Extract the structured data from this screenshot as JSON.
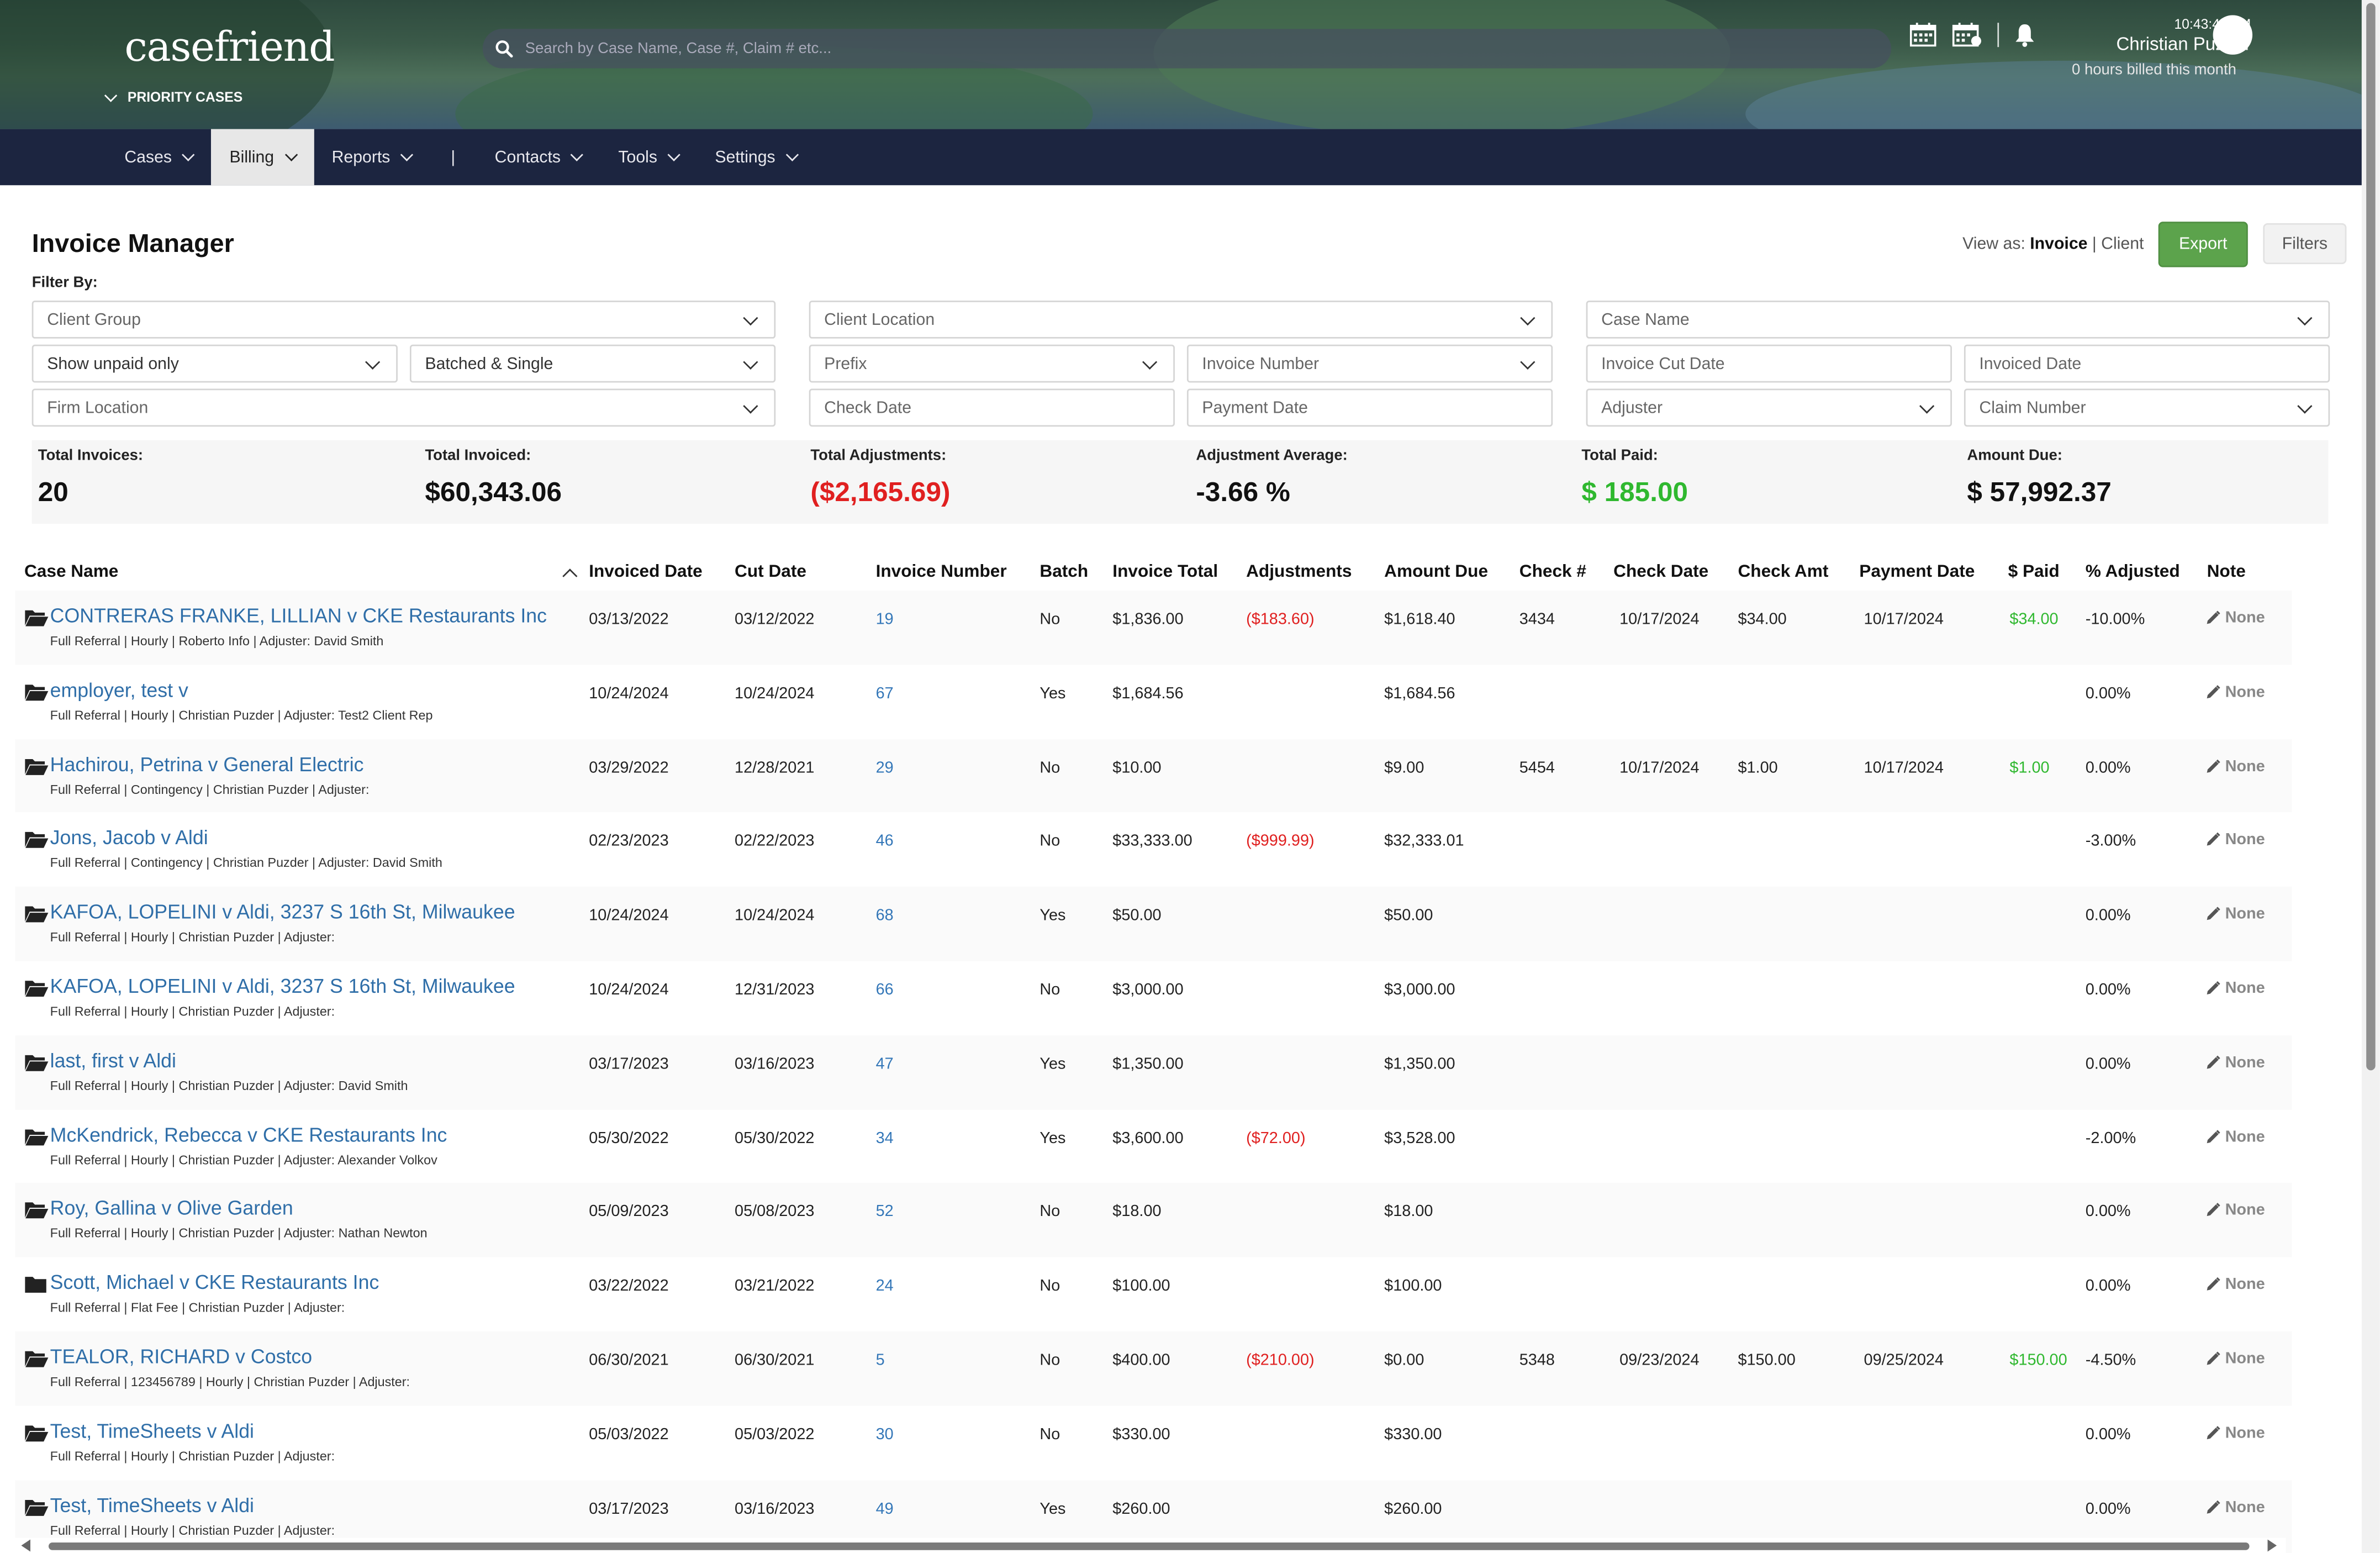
{
  "brand": {
    "logo_text": "casefriend",
    "priority_label": "PRIORITY CASES"
  },
  "search": {
    "placeholder": "Search by Case Name, Case #, Claim # etc..."
  },
  "header": {
    "clock": "10:43:43 AM",
    "user_name": "Christian Puzder",
    "billed": "0 hours billed this month"
  },
  "nav": [
    "Cases",
    "Billing",
    "Reports",
    "|",
    "Contacts",
    "Tools",
    "Settings"
  ],
  "page": {
    "title": "Invoice Manager",
    "view_as_label": "View as:",
    "view_invoice": "Invoice",
    "view_sep": "|",
    "view_client": "Client",
    "export_label": "Export",
    "filters_label": "Filters",
    "filter_by": "Filter By:"
  },
  "filters": {
    "client_group": "Client Group",
    "client_location": "Client Location",
    "case_name": "Case Name",
    "unpaid": "Show unpaid only",
    "batched": "Batched & Single",
    "prefix": "Prefix",
    "invoice_number": "Invoice Number",
    "invoice_cut_date": "Invoice Cut Date",
    "invoiced_date": "Invoiced Date",
    "firm_location": "Firm Location",
    "check_date": "Check Date",
    "payment_date": "Payment Date",
    "adjuster": "Adjuster",
    "claim_number": "Claim Number"
  },
  "summary": {
    "total_invoices_label": "Total Invoices:",
    "total_invoices": "20",
    "total_invoiced_label": "Total Invoiced:",
    "total_invoiced": "$60,343.06",
    "total_adjustments_label": "Total Adjustments:",
    "total_adjustments": "($2,165.69)",
    "adjustment_average_label": "Adjustment Average:",
    "adjustment_average": "-3.66 %",
    "total_paid_label": "Total Paid:",
    "total_paid": "$ 185.00",
    "amount_due_label": "Amount Due:",
    "amount_due": "$ 57,992.37"
  },
  "table": {
    "headers": {
      "case_name": "Case Name",
      "invoiced_date": "Invoiced Date",
      "cut_date": "Cut Date",
      "invoice_number": "Invoice Number",
      "batch": "Batch",
      "invoice_total": "Invoice Total",
      "adjustments": "Adjustments",
      "amount_due": "Amount Due",
      "check_no": "Check #",
      "check_date": "Check Date",
      "check_amt": "Check Amt",
      "payment_date": "Payment Date",
      "paid": "$ Paid",
      "pct_adjusted": "% Adjusted",
      "note": "Note"
    },
    "rows": [
      {
        "case": "CONTRERAS FRANKE, LILLIAN v CKE Restaurants Inc",
        "sub": "Full Referral | Hourly | Roberto Info | Adjuster: David Smith",
        "invoiced": "03/13/2022",
        "cut": "03/12/2022",
        "inv": "19",
        "batch": "No",
        "total": "$1,836.00",
        "adj": "($183.60)",
        "due": "$1,618.40",
        "check": "3434",
        "check_date": "10/17/2024",
        "check_amt": "$34.00",
        "pay_date": "10/17/2024",
        "paid": "$34.00",
        "pct": "-10.00%",
        "note": "None"
      },
      {
        "case": "employer, test v",
        "sub": "Full Referral | Hourly | Christian Puzder | Adjuster: Test2 Client Rep",
        "invoiced": "10/24/2024",
        "cut": "10/24/2024",
        "inv": "67",
        "batch": "Yes",
        "total": "$1,684.56",
        "adj": "",
        "due": "$1,684.56",
        "check": "",
        "check_date": "",
        "check_amt": "",
        "pay_date": "",
        "paid": "",
        "pct": "0.00%",
        "note": "None"
      },
      {
        "case": "Hachirou, Petrina v General Electric",
        "sub": "Full Referral | Contingency | Christian Puzder | Adjuster:",
        "invoiced": "03/29/2022",
        "cut": "12/28/2021",
        "inv": "29",
        "batch": "No",
        "total": "$10.00",
        "adj": "",
        "due": "$9.00",
        "check": "5454",
        "check_date": "10/17/2024",
        "check_amt": "$1.00",
        "pay_date": "10/17/2024",
        "paid": "$1.00",
        "pct": "0.00%",
        "note": "None"
      },
      {
        "case": "Jons, Jacob v Aldi",
        "sub": "Full Referral | Contingency | Christian Puzder | Adjuster: David Smith",
        "invoiced": "02/23/2023",
        "cut": "02/22/2023",
        "inv": "46",
        "batch": "No",
        "total": "$33,333.00",
        "adj": "($999.99)",
        "due": "$32,333.01",
        "check": "",
        "check_date": "",
        "check_amt": "",
        "pay_date": "",
        "paid": "",
        "pct": "-3.00%",
        "note": "None"
      },
      {
        "case": "KAFOA, LOPELINI v Aldi, 3237 S 16th St, Milwaukee",
        "sub": "Full Referral | Hourly | Christian Puzder | Adjuster:",
        "invoiced": "10/24/2024",
        "cut": "10/24/2024",
        "inv": "68",
        "batch": "Yes",
        "total": "$50.00",
        "adj": "",
        "due": "$50.00",
        "check": "",
        "check_date": "",
        "check_amt": "",
        "pay_date": "",
        "paid": "",
        "pct": "0.00%",
        "note": "None"
      },
      {
        "case": "KAFOA, LOPELINI v Aldi, 3237 S 16th St, Milwaukee",
        "sub": "Full Referral | Hourly | Christian Puzder | Adjuster:",
        "invoiced": "10/24/2024",
        "cut": "12/31/2023",
        "inv": "66",
        "batch": "No",
        "total": "$3,000.00",
        "adj": "",
        "due": "$3,000.00",
        "check": "",
        "check_date": "",
        "check_amt": "",
        "pay_date": "",
        "paid": "",
        "pct": "0.00%",
        "note": "None"
      },
      {
        "case": "last, first v Aldi",
        "sub": "Full Referral | Hourly | Christian Puzder | Adjuster: David Smith",
        "invoiced": "03/17/2023",
        "cut": "03/16/2023",
        "inv": "47",
        "batch": "Yes",
        "total": "$1,350.00",
        "adj": "",
        "due": "$1,350.00",
        "check": "",
        "check_date": "",
        "check_amt": "",
        "pay_date": "",
        "paid": "",
        "pct": "0.00%",
        "note": "None"
      },
      {
        "case": "McKendrick, Rebecca v CKE Restaurants Inc",
        "sub": "Full Referral | Hourly | Christian Puzder | Adjuster: Alexander Volkov",
        "invoiced": "05/30/2022",
        "cut": "05/30/2022",
        "inv": "34",
        "batch": "Yes",
        "total": "$3,600.00",
        "adj": "($72.00)",
        "due": "$3,528.00",
        "check": "",
        "check_date": "",
        "check_amt": "",
        "pay_date": "",
        "paid": "",
        "pct": "-2.00%",
        "note": "None"
      },
      {
        "case": "Roy, Gallina v Olive Garden",
        "sub": "Full Referral | Hourly | Christian Puzder | Adjuster: Nathan Newton",
        "invoiced": "05/09/2023",
        "cut": "05/08/2023",
        "inv": "52",
        "batch": "No",
        "total": "$18.00",
        "adj": "",
        "due": "$18.00",
        "check": "",
        "check_date": "",
        "check_amt": "",
        "pay_date": "",
        "paid": "",
        "pct": "0.00%",
        "note": "None"
      },
      {
        "case": "Scott, Michael v CKE Restaurants Inc",
        "sub": "Full Referral | Flat Fee | Christian Puzder | Adjuster:",
        "invoiced": "03/22/2022",
        "cut": "03/21/2022",
        "inv": "24",
        "batch": "No",
        "total": "$100.00",
        "adj": "",
        "due": "$100.00",
        "check": "",
        "check_date": "",
        "check_amt": "",
        "pay_date": "",
        "paid": "",
        "pct": "0.00%",
        "note": "None"
      },
      {
        "case": "TEALOR, RICHARD v Costco",
        "sub": "Full Referral | 123456789 | Hourly | Christian Puzder | Adjuster:",
        "invoiced": "06/30/2021",
        "cut": "06/30/2021",
        "inv": "5",
        "batch": "No",
        "total": "$400.00",
        "adj": "($210.00)",
        "due": "$0.00",
        "check": "5348",
        "check_date": "09/23/2024",
        "check_amt": "$150.00",
        "pay_date": "09/25/2024",
        "paid": "$150.00",
        "pct": "-4.50%",
        "note": "None"
      },
      {
        "case": "Test, TimeSheets v Aldi",
        "sub": "Full Referral | Hourly | Christian Puzder | Adjuster:",
        "invoiced": "05/03/2022",
        "cut": "05/03/2022",
        "inv": "30",
        "batch": "No",
        "total": "$330.00",
        "adj": "",
        "due": "$330.00",
        "check": "",
        "check_date": "",
        "check_amt": "",
        "pay_date": "",
        "paid": "",
        "pct": "0.00%",
        "note": "None"
      },
      {
        "case": "Test, TimeSheets v Aldi",
        "sub": "Full Referral | Hourly | Christian Puzder | Adjuster:",
        "invoiced": "03/17/2023",
        "cut": "03/16/2023",
        "inv": "49",
        "batch": "Yes",
        "total": "$260.00",
        "adj": "",
        "due": "$260.00",
        "check": "",
        "check_date": "",
        "check_amt": "",
        "pay_date": "",
        "paid": "",
        "pct": "0.00%",
        "note": "None"
      }
    ]
  },
  "colors": {
    "nav_bg": "#1c2540",
    "export_green": "#5ca34c",
    "link_blue": "#2f6ea8",
    "negative_red": "#e02020",
    "paid_green": "#2fb82f"
  },
  "icons": [
    "search-icon",
    "calendar-icon",
    "calendar-grid-icon",
    "bell-icon",
    "folder-open-icon",
    "folder-closed-icon",
    "pencil-icon",
    "chevron-down-icon",
    "sort-up-icon"
  ]
}
